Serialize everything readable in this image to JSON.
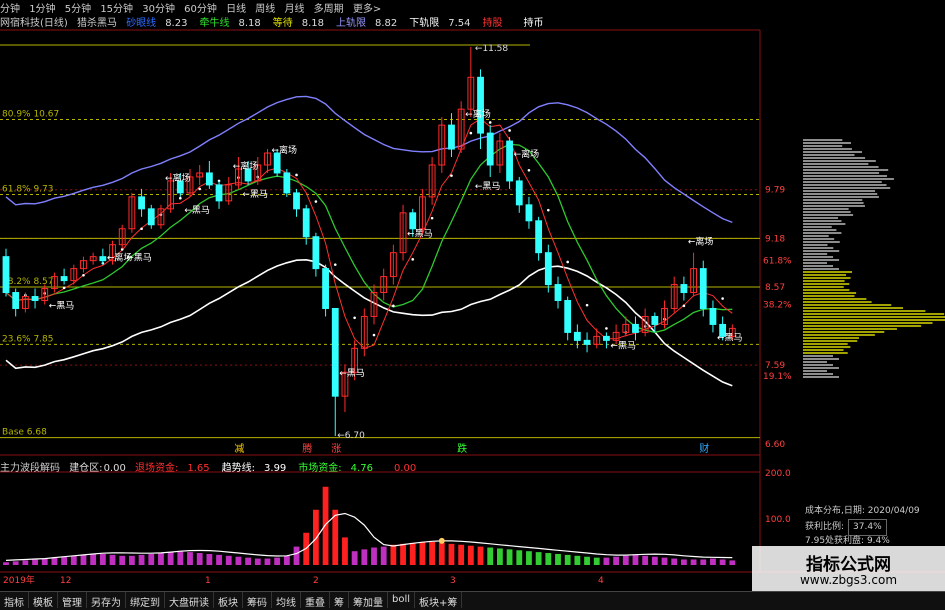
{
  "period_tabs": [
    "分钟",
    "1分钟",
    "5分钟",
    "15分钟",
    "30分钟",
    "60分钟",
    "日线",
    "周线",
    "月线",
    "多周期",
    "更多>"
  ],
  "main_header": {
    "title": "网宿科技(日线)",
    "indicator": "猎杀黑马",
    "items": [
      {
        "label": "砂眼线",
        "value": "8.23",
        "color": "#2f6bff"
      },
      {
        "label": "牵牛线",
        "value": "8.18",
        "color": "#2fe02f"
      },
      {
        "label": "等待",
        "value": "8.18",
        "color": "#e0e000"
      },
      {
        "label": "上轨限",
        "value": "8.82",
        "color": "#9a9aff"
      },
      {
        "label": "下轨限",
        "value": "7.54",
        "color": "#ffffff"
      },
      {
        "label": "持股",
        "value": "",
        "color": "#ff3030"
      },
      {
        "label": "持币",
        "value": "",
        "color": "#ffffff"
      }
    ]
  },
  "fib_labels": [
    {
      "text": "80.9% 10.67",
      "price": 10.67
    },
    {
      "text": "61.8% 9.73",
      "price": 9.73
    },
    {
      "text": "38.2% 8.57",
      "price": 8.57
    },
    {
      "text": "23.6% 7.85",
      "price": 7.85
    },
    {
      "text": "Base 6.68",
      "price": 6.68
    }
  ],
  "high_label": "11.58",
  "low_label": "6.70",
  "right_axis": {
    "prices": [
      "9.79",
      "9.18",
      "8.57",
      "7.59",
      "6.60"
    ],
    "pcts": [
      {
        "text": "61.8%",
        "color": "#ff4040"
      },
      {
        "text": "38.2%",
        "color": "#ff4040"
      },
      {
        "text": "19.1%",
        "color": "#ff4040"
      }
    ]
  },
  "chart_labels": {
    "liqu": "离场",
    "heima": "黑马"
  },
  "signal_chars": [
    {
      "text": "减",
      "color": "#ffcc00"
    },
    {
      "text": "腾",
      "color": "#ff4040"
    },
    {
      "text": "涨",
      "color": "#ff4040"
    },
    {
      "text": "跌",
      "color": "#33ff33"
    },
    {
      "text": "财",
      "color": "#33aaff"
    }
  ],
  "sub_header": {
    "title": "主力波段解码",
    "jian_label": "建仓区:",
    "jian_value": "0.00",
    "items": [
      {
        "label": "退场资金:",
        "value": "1.65",
        "color": "#ff3030"
      },
      {
        "label": "趋势线:",
        "value": "3.99",
        "color": "#ffffff"
      },
      {
        "label": "市场资金:",
        "value": "4.76",
        "color": "#33ff33"
      },
      {
        "label": "",
        "value": "0.00",
        "color": "#ff3030"
      }
    ]
  },
  "sub_axis": [
    "200.0",
    "100.0"
  ],
  "date_axis": {
    "labels": [
      "2019年",
      "12",
      "1",
      "2",
      "3",
      "4"
    ]
  },
  "info_panel": {
    "date_label": "成本分布,日期:",
    "date_value": "2020/04/09",
    "profit_label": "获利比例:",
    "profit_value": "37.4%",
    "profit_line": "7.95处获利盘:",
    "profit_line_value": "9.4%"
  },
  "watermark": {
    "title": "指标公式网",
    "url": "www.zbgs3.com"
  },
  "tabs": [
    "指标",
    "模板",
    "管理",
    "另存为",
    "绑定到",
    "大盘研读",
    "板块",
    "筹码",
    "均线",
    "重叠",
    "筹",
    "筹加量",
    "boll",
    "板块+筹"
  ],
  "colors": {
    "up": "#ff2a2a",
    "down": "#33ffff",
    "fib": "#b5b500",
    "grid": "#8a1010"
  },
  "chart_data": {
    "type": "candlestick",
    "title": "网宿科技(日线)",
    "y_ticks": [
      9.79,
      9.18,
      8.57,
      7.59,
      6.6
    ],
    "fib_levels": {
      "80.9%": 10.67,
      "61.8%": 9.73,
      "38.2%": 8.57,
      "23.6%": 7.85,
      "Base": 6.68
    },
    "x_ticks": [
      "2019年",
      "12",
      "1",
      "2",
      "3",
      "4"
    ],
    "high": 11.58,
    "low": 6.7,
    "candles": [
      [
        8.95,
        8.5,
        9.05,
        8.45
      ],
      [
        8.5,
        8.3,
        8.55,
        8.2
      ],
      [
        8.3,
        8.45,
        8.5,
        8.25
      ],
      [
        8.45,
        8.4,
        8.55,
        8.3
      ],
      [
        8.4,
        8.55,
        8.6,
        8.35
      ],
      [
        8.55,
        8.7,
        8.75,
        8.5
      ],
      [
        8.7,
        8.65,
        8.8,
        8.6
      ],
      [
        8.65,
        8.8,
        8.85,
        8.6
      ],
      [
        8.8,
        8.9,
        8.95,
        8.75
      ],
      [
        8.9,
        8.95,
        9.0,
        8.85
      ],
      [
        8.95,
        8.9,
        9.05,
        8.85
      ],
      [
        8.9,
        9.1,
        9.15,
        8.85
      ],
      [
        9.1,
        9.3,
        9.35,
        9.05
      ],
      [
        9.3,
        9.7,
        9.75,
        9.25
      ],
      [
        9.7,
        9.55,
        9.8,
        9.45
      ],
      [
        9.55,
        9.35,
        9.6,
        9.3
      ],
      [
        9.35,
        9.55,
        9.6,
        9.3
      ],
      [
        9.55,
        9.9,
        10.0,
        9.5
      ],
      [
        9.9,
        9.75,
        10.0,
        9.7
      ],
      [
        9.75,
        9.95,
        10.05,
        9.7
      ],
      [
        9.95,
        10.0,
        10.1,
        9.85
      ],
      [
        10.0,
        9.85,
        10.15,
        9.8
      ],
      [
        9.85,
        9.65,
        9.9,
        9.55
      ],
      [
        9.65,
        9.85,
        9.95,
        9.6
      ],
      [
        9.85,
        10.05,
        10.2,
        9.8
      ],
      [
        10.05,
        9.9,
        10.15,
        9.85
      ],
      [
        9.9,
        10.1,
        10.2,
        9.85
      ],
      [
        10.1,
        10.25,
        10.3,
        10.0
      ],
      [
        10.25,
        10.0,
        10.3,
        9.95
      ],
      [
        10.0,
        9.75,
        10.05,
        9.7
      ],
      [
        9.75,
        9.55,
        9.8,
        9.45
      ],
      [
        9.55,
        9.2,
        9.6,
        9.1
      ],
      [
        9.2,
        8.8,
        9.25,
        8.7
      ],
      [
        8.8,
        8.3,
        8.85,
        8.2
      ],
      [
        8.3,
        7.2,
        8.3,
        6.7
      ],
      [
        7.2,
        7.5,
        7.6,
        7.0
      ],
      [
        7.5,
        7.8,
        7.9,
        7.4
      ],
      [
        7.8,
        8.2,
        8.3,
        7.7
      ],
      [
        8.2,
        8.5,
        8.6,
        8.1
      ],
      [
        8.5,
        8.7,
        8.8,
        8.4
      ],
      [
        8.7,
        9.0,
        9.1,
        8.6
      ],
      [
        9.0,
        9.5,
        9.6,
        8.9
      ],
      [
        9.5,
        9.3,
        9.55,
        9.2
      ],
      [
        9.3,
        9.7,
        9.8,
        9.25
      ],
      [
        9.7,
        10.1,
        10.2,
        9.6
      ],
      [
        10.1,
        10.6,
        10.7,
        10.0
      ],
      [
        10.6,
        10.3,
        10.75,
        10.2
      ],
      [
        10.3,
        10.8,
        10.9,
        10.25
      ],
      [
        10.8,
        11.2,
        11.58,
        10.7
      ],
      [
        11.2,
        10.5,
        11.3,
        10.3
      ],
      [
        10.5,
        10.1,
        10.6,
        9.95
      ],
      [
        10.1,
        10.4,
        10.5,
        10.0
      ],
      [
        10.4,
        9.9,
        10.45,
        9.8
      ],
      [
        9.9,
        9.6,
        9.95,
        9.5
      ],
      [
        9.6,
        9.4,
        9.7,
        9.3
      ],
      [
        9.4,
        9.0,
        9.45,
        8.9
      ],
      [
        9.0,
        8.6,
        9.1,
        8.5
      ],
      [
        8.6,
        8.4,
        8.7,
        8.3
      ],
      [
        8.4,
        8.0,
        8.45,
        7.9
      ],
      [
        8.0,
        7.9,
        8.1,
        7.8
      ],
      [
        7.9,
        7.85,
        8.0,
        7.75
      ],
      [
        7.85,
        7.95,
        8.05,
        7.8
      ],
      [
        7.95,
        7.9,
        8.0,
        7.8
      ],
      [
        7.9,
        8.0,
        8.1,
        7.85
      ],
      [
        8.0,
        8.1,
        8.2,
        7.95
      ],
      [
        8.1,
        8.0,
        8.2,
        7.9
      ],
      [
        8.0,
        8.2,
        8.3,
        7.95
      ],
      [
        8.2,
        8.1,
        8.25,
        8.0
      ],
      [
        8.1,
        8.3,
        8.4,
        8.05
      ],
      [
        8.3,
        8.6,
        8.7,
        8.25
      ],
      [
        8.6,
        8.5,
        8.7,
        8.4
      ],
      [
        8.5,
        8.8,
        9.0,
        8.45
      ],
      [
        8.8,
        8.3,
        8.9,
        8.2
      ],
      [
        8.3,
        8.1,
        8.4,
        8.0
      ],
      [
        8.1,
        7.95,
        8.2,
        7.9
      ],
      [
        7.95,
        8.05,
        8.1,
        7.9
      ]
    ],
    "sub_volume": [
      6,
      8,
      10,
      12,
      14,
      16,
      18,
      20,
      22,
      24,
      24,
      22,
      20,
      20,
      22,
      24,
      26,
      28,
      30,
      28,
      26,
      24,
      22,
      20,
      18,
      16,
      14,
      14,
      16,
      20,
      40,
      70,
      120,
      170,
      120,
      60,
      30,
      34,
      38,
      40,
      44,
      46,
      48,
      50,
      50,
      48,
      46,
      44,
      42,
      40,
      38,
      36,
      34,
      32,
      30,
      28,
      26,
      24,
      22,
      20,
      18,
      16,
      16,
      18,
      20,
      22,
      20,
      18,
      16,
      14,
      12,
      12,
      12,
      14,
      12,
      10
    ]
  }
}
